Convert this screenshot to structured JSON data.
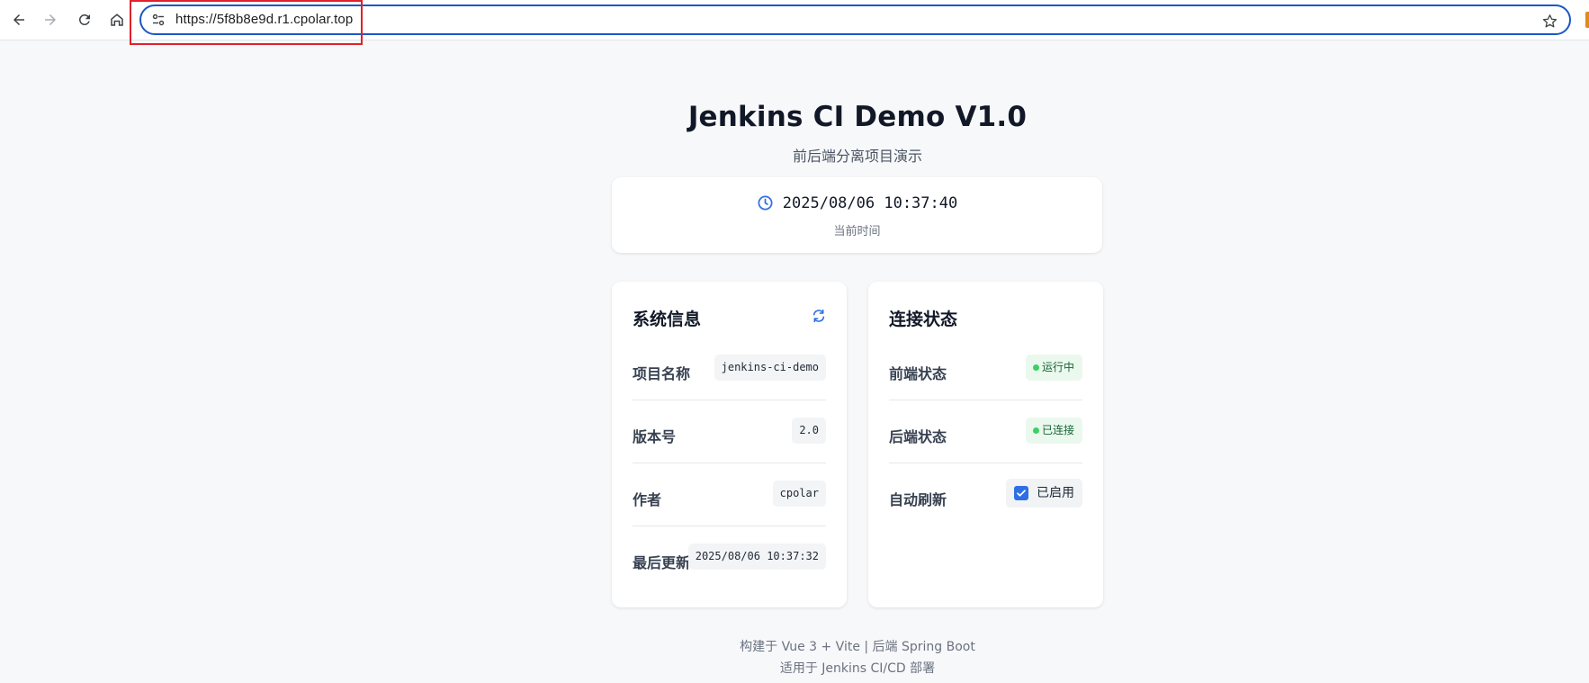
{
  "browser": {
    "url": "https://5f8b8e9d.r1.cpolar.top",
    "icons": {
      "back": "arrow-left-icon",
      "forward": "arrow-right-icon",
      "reload": "reload-icon",
      "home": "home-icon",
      "site_info": "tune-icon",
      "bookmark": "star-icon"
    }
  },
  "page": {
    "title": "Jenkins CI Demo V1.0",
    "subtitle": "前后端分离项目演示"
  },
  "clock": {
    "time": "2025/08/06 10:37:40",
    "label": "当前时间"
  },
  "system_info": {
    "title": "系统信息",
    "rows": [
      {
        "label": "项目名称",
        "value": "jenkins-ci-demo"
      },
      {
        "label": "版本号",
        "value": "2.0"
      },
      {
        "label": "作者",
        "value": "cpolar"
      },
      {
        "label": "最后更新",
        "value": "2025/08/06 10:37:32"
      }
    ]
  },
  "connection": {
    "title": "连接状态",
    "frontend": {
      "label": "前端状态",
      "status": "运行中"
    },
    "backend": {
      "label": "后端状态",
      "status": "已连接"
    },
    "auto_refresh": {
      "label": "自动刷新",
      "text": "已启用",
      "checked": true
    }
  },
  "footer": {
    "line1": "构建于 Vue 3 + Vite | 后端 Spring Boot",
    "line2": "适用于 Jenkins CI/CD 部署"
  },
  "colors": {
    "accent": "#2f6fe4",
    "highlight": "#e0202a",
    "status_green": "#3ad068",
    "background": "#f7f8fa"
  }
}
